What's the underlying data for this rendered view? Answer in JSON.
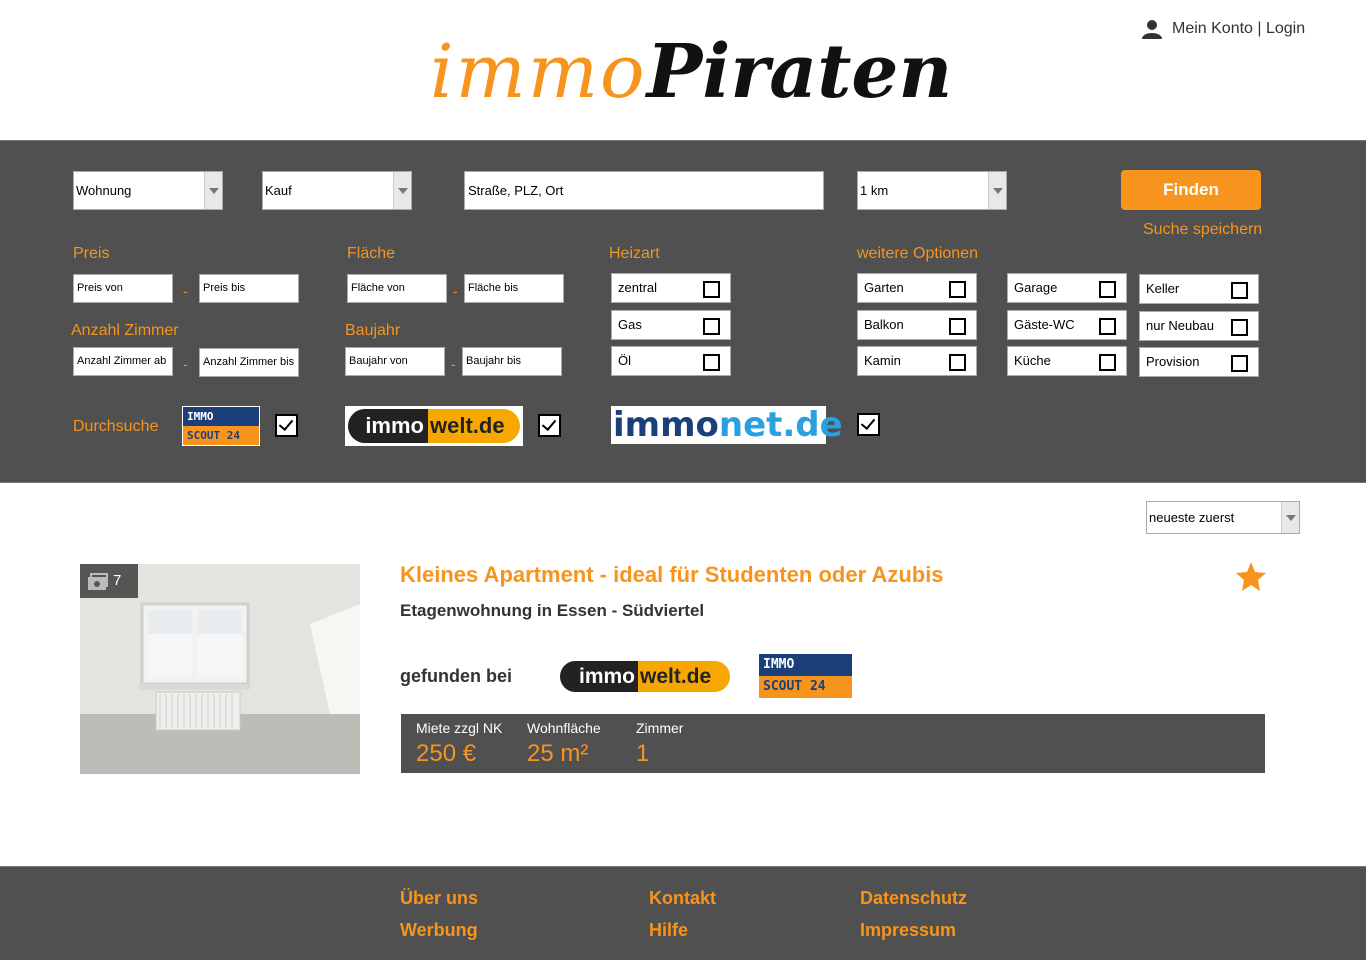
{
  "header": {
    "logo_part1": "immo",
    "logo_part2": "Piraten",
    "account_label": "Mein Konto | Login"
  },
  "search": {
    "property_type": "Wohnung",
    "offer_type": "Kauf",
    "location_placeholder": "Straße, PLZ, Ort",
    "radius": "1 km",
    "find_button": "Finden",
    "save_search": "Suche speichern"
  },
  "filters": {
    "price_label": "Preis",
    "price_from": "Preis von",
    "price_to": "Preis bis",
    "area_label": "Fläche",
    "area_from": "Fläche von",
    "area_to": "Fläche bis",
    "rooms_label": "Anzahl Zimmer",
    "rooms_from": "Anzahl Zimmer ab",
    "rooms_to": "Anzahl Zimmer bis",
    "year_label": "Baujahr",
    "year_from": "Baujahr von",
    "year_to": "Baujahr bis",
    "dash": "-",
    "heating_label": "Heizart",
    "heating": [
      "zentral",
      "Gas",
      "Öl"
    ],
    "options_label": "weitere Optionen",
    "options_col1": [
      "Garten",
      "Balkon",
      "Kamin"
    ],
    "options_col2": [
      "Garage",
      "Gäste-WC",
      "Küche"
    ],
    "options_col3": [
      "Keller",
      "nur Neubau",
      "Provision"
    ]
  },
  "sources": {
    "label": "Durchsuche",
    "is24_top": "IMMO",
    "is24_bottom": "SCOUT 24",
    "immowelt_a": "immo",
    "immowelt_b": "welt.de",
    "immonet_a": "immo",
    "immonet_b": "net.de"
  },
  "results": {
    "sort": "neueste zuerst",
    "listing": {
      "photo_count": "7",
      "title": "Kleines Apartment - ideal für Studenten oder Azubis",
      "subtitle": "Etagenwohnung in Essen - Südviertel",
      "found_at": "gefunden bei",
      "rent_label": "Miete zzgl NK",
      "rent_value": "250 €",
      "area_label": "Wohnfläche",
      "area_value": "25 m²",
      "rooms_label": "Zimmer",
      "rooms_value": "1"
    }
  },
  "footer": {
    "about": "Über uns",
    "ads": "Werbung",
    "contact": "Kontakt",
    "help": "Hilfe",
    "privacy": "Datenschutz",
    "imprint": "Impressum"
  },
  "colors": {
    "accent": "#f7941d",
    "panel": "#505050",
    "is24_blue": "#1a3f7a",
    "immowelt_yellow": "#f7a800",
    "immonet_blue": "#1a3f7a",
    "immonet_light": "#2aa0e0"
  }
}
